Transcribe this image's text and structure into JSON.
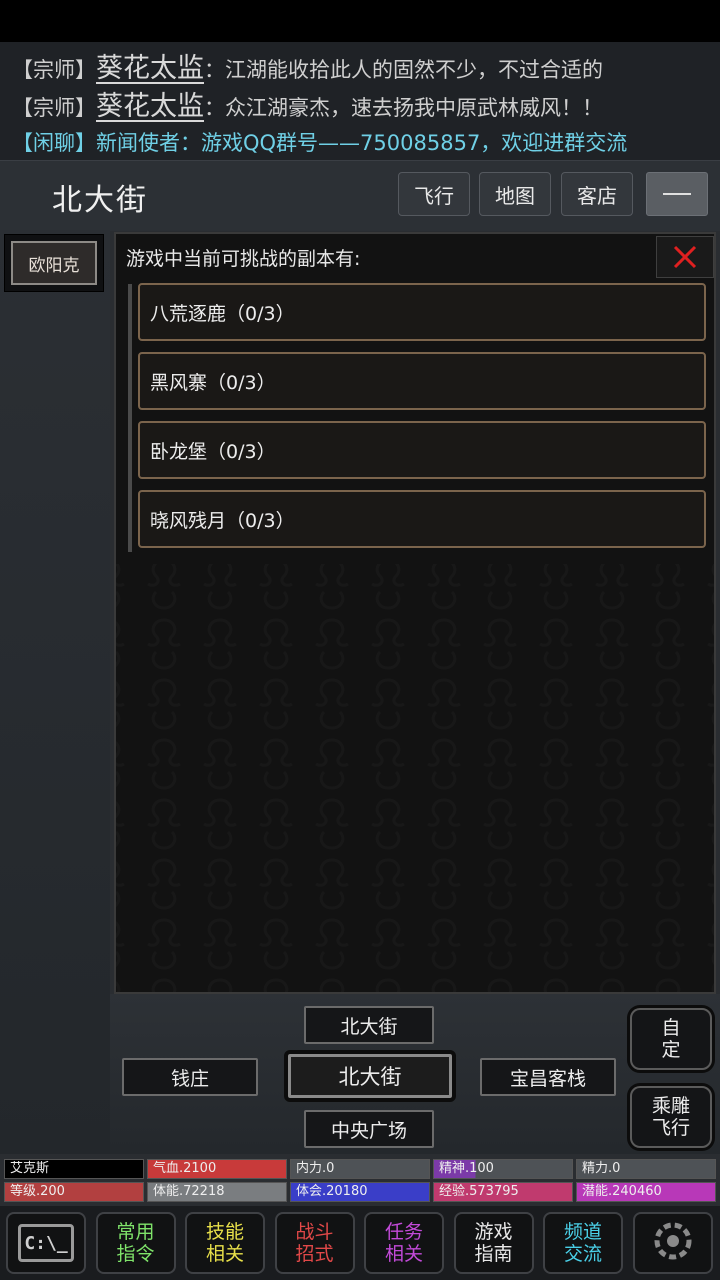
{
  "chat": [
    {
      "tag": "【宗师】",
      "name": "葵花太监",
      "msg": "：江湖能收拾此人的固然不少，不过合适的"
    },
    {
      "tag": "【宗师】",
      "name": "葵花太监",
      "msg": "：众江湖豪杰，速去扬我中原武林威风！！"
    },
    {
      "tag": "【闲聊】",
      "name": "新闻使者",
      "msg": "：游戏QQ群号——750085857，欢迎进群交流"
    }
  ],
  "header": {
    "location": "北大街",
    "buttons": [
      "飞行",
      "地图",
      "客店"
    ]
  },
  "npc": {
    "name": "欧阳克"
  },
  "dialog": {
    "title": "游戏中当前可挑战的副本有:",
    "close_icon": "close-x-icon",
    "items": [
      "八荒逐鹿（0/3）",
      "黑风寨（0/3）",
      "卧龙堡（0/3）",
      "晓风残月（0/3）"
    ]
  },
  "nav": {
    "north": "北大街",
    "west": "钱庄",
    "center": "北大街",
    "east": "宝昌客栈",
    "south": "中央广场",
    "custom": "自定",
    "eagle": "乘雕飞行"
  },
  "stats": [
    {
      "label": "艾克斯",
      "color": "#000000",
      "fill": 1.0
    },
    {
      "label": "气血.2100",
      "color": "#c83a3a",
      "fill": 1.0
    },
    {
      "label": "内力.0",
      "color": "#4e5256",
      "fill": 1.0
    },
    {
      "label": "精神.100",
      "color": "#7b3aa8",
      "fill": 0.3
    },
    {
      "label": "精力.0",
      "color": "#4e5256",
      "fill": 1.0
    },
    {
      "label": "等级.200",
      "color": "#b24040",
      "fill": 1.0
    },
    {
      "label": "体能.72218",
      "color": "#7a7d80",
      "fill": 1.0
    },
    {
      "label": "体会.20180",
      "color": "#3a3ec8",
      "fill": 1.0
    },
    {
      "label": "经验.573795",
      "color": "#c03a6e",
      "fill": 1.0
    },
    {
      "label": "潜能.240460",
      "color": "#b838b8",
      "fill": 1.0
    }
  ],
  "toolbar": [
    {
      "type": "icon",
      "icon": "console-icon",
      "text": "C:\\_",
      "color": "#cfcfcf"
    },
    {
      "type": "text",
      "text": "常用\n指令",
      "color": "#7fe36a"
    },
    {
      "type": "text",
      "text": "技能\n相关",
      "color": "#e8e04a"
    },
    {
      "type": "text",
      "text": "战斗\n招式",
      "color": "#e04848"
    },
    {
      "type": "text",
      "text": "任务\n相关",
      "color": "#c24ad8"
    },
    {
      "type": "text",
      "text": "游戏\n指南",
      "color": "#e8e8e8"
    },
    {
      "type": "text",
      "text": "频道\n交流",
      "color": "#4ad0e8"
    },
    {
      "type": "icon",
      "icon": "settings-icon",
      "text": "",
      "color": "#cfcfcf"
    }
  ]
}
